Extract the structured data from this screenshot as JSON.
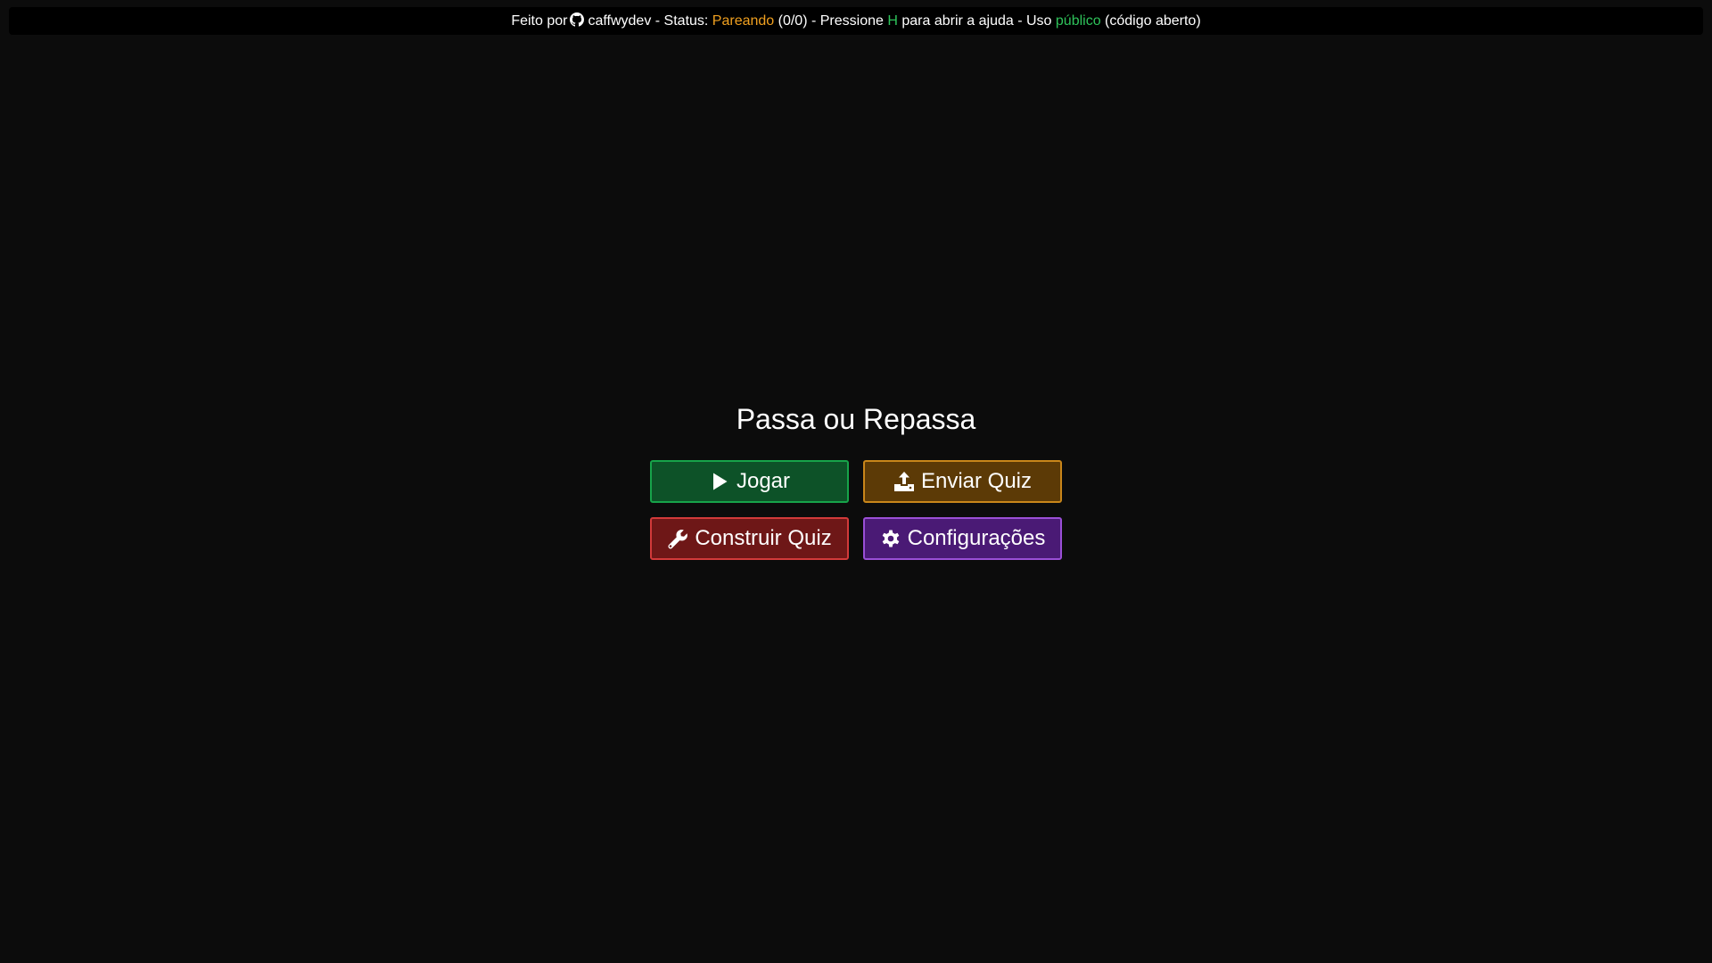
{
  "topbar": {
    "made_by": "Feito por",
    "author": "caffwydev",
    "status_sep": " - Status: ",
    "status_value": "Pareando",
    "status_count": " (0/0) - Pressione ",
    "help_key": "H",
    "help_text": " para abrir a ajuda - Uso ",
    "usage_value": "público",
    "usage_note": " (código aberto)"
  },
  "main": {
    "title": "Passa ou Repassa",
    "buttons": {
      "play": "Jogar",
      "upload": "Enviar Quiz",
      "build": "Construir Quiz",
      "settings": "Configurações"
    }
  },
  "colors": {
    "background": "#0c0c0c",
    "status_orange": "#f0a020",
    "accent_green": "#2ec25a",
    "play_bg": "#0d5228",
    "upload_bg": "#5c3a06",
    "build_bg": "#6e1717",
    "settings_bg": "#4a1a75"
  },
  "icons": {
    "author": "github-icon",
    "play": "play-icon",
    "upload": "upload-icon",
    "build": "wrench-icon",
    "settings": "gear-icon"
  }
}
